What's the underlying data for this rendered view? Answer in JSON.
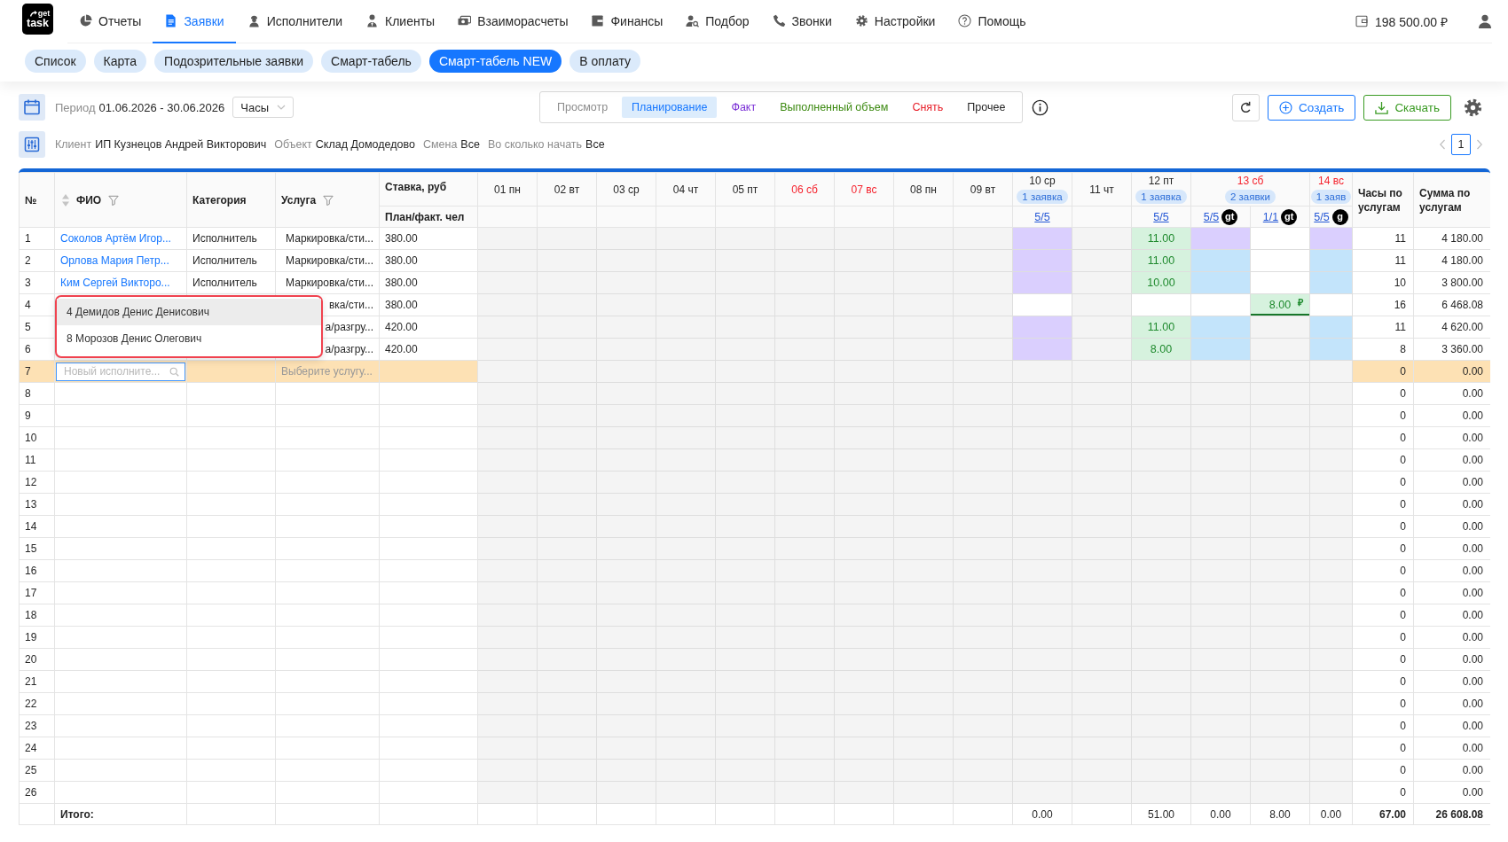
{
  "logo": {
    "lines": [
      "get",
      "task"
    ]
  },
  "nav": {
    "items": [
      {
        "label": "Отчеты",
        "selected": false
      },
      {
        "label": "Заявки",
        "selected": true
      },
      {
        "label": "Исполнители",
        "selected": false
      },
      {
        "label": "Клиенты",
        "selected": false
      },
      {
        "label": "Взаиморасчеты",
        "selected": false
      },
      {
        "label": "Финансы",
        "selected": false
      },
      {
        "label": "Подбор",
        "selected": false
      },
      {
        "label": "Звонки",
        "selected": false
      },
      {
        "label": "Настройки",
        "selected": false
      },
      {
        "label": "Помощь",
        "selected": false
      }
    ],
    "balance": "198 500.00 ₽"
  },
  "subnav": {
    "items": [
      {
        "label": "Список",
        "selected": false
      },
      {
        "label": "Карта",
        "selected": false
      },
      {
        "label": "Подозрительные заявки",
        "selected": false
      },
      {
        "label": "Смарт-табель",
        "selected": false
      },
      {
        "label": "Смарт-табель NEW",
        "selected": true
      },
      {
        "label": "В оплату",
        "selected": false
      }
    ]
  },
  "toolbar": {
    "period": {
      "label": "Период",
      "value": "01.06.2026 - 30.06.2026"
    },
    "unit_select": {
      "value": "Часы"
    },
    "modes": [
      {
        "label": "Просмотр",
        "color": "#8c8c8c",
        "selected": false
      },
      {
        "label": "Планирование",
        "color": "#1677ff",
        "selected": true
      },
      {
        "label": "Факт",
        "color": "#7a2fd6",
        "selected": false
      },
      {
        "label": "Выполненный объем",
        "color": "#3d8a12",
        "selected": false
      },
      {
        "label": "Снять",
        "color": "#e8202a",
        "selected": false
      },
      {
        "label": "Прочее",
        "color": "#1f1f1f",
        "selected": false
      }
    ],
    "buttons": [
      {
        "label": "Создать",
        "kind": "create"
      },
      {
        "label": "Скачать",
        "kind": "download"
      }
    ]
  },
  "filters": [
    {
      "label": "Клиент",
      "value": "ИП Кузнецов Андрей Викторович"
    },
    {
      "label": "Объект",
      "value": "Склад Домодедово"
    },
    {
      "label": "Смена",
      "value": "Все"
    },
    {
      "label": "Во сколько начать",
      "value": "Все"
    }
  ],
  "pagination": {
    "pages": [
      {
        "label": "1",
        "selected": true
      }
    ]
  },
  "table": {
    "columns": {
      "number": "№",
      "name": "ФИО",
      "category": "Категория",
      "service": "Услуга",
      "rate": "Ставка, руб",
      "rate_sub": "План/факт. чел",
      "hours": "Часы по услугам",
      "sum": "Сумма по услугам"
    },
    "days": [
      {
        "label": "01 пн",
        "weekend": false
      },
      {
        "label": "02 вт",
        "weekend": false
      },
      {
        "label": "03 ср",
        "weekend": false
      },
      {
        "label": "04 чт",
        "weekend": false
      },
      {
        "label": "05 пт",
        "weekend": false
      },
      {
        "label": "06 сб",
        "weekend": true
      },
      {
        "label": "07 вс",
        "weekend": true
      },
      {
        "label": "08 пн",
        "weekend": false
      },
      {
        "label": "09 вт",
        "weekend": false
      },
      {
        "label": "10 ср",
        "weekend": false,
        "badge": "1 заявка",
        "slots": [
          {
            "ratio": "5/5",
            "total": "0.00"
          }
        ]
      },
      {
        "label": "11 чт",
        "weekend": false
      },
      {
        "label": "12 пт",
        "weekend": false,
        "badge": "1 заявка",
        "slots": [
          {
            "ratio": "5/5",
            "total": "51.00"
          }
        ]
      },
      {
        "label": "13 сб",
        "weekend": true,
        "badge": "2 заявки",
        "slots": [
          {
            "ratio": "5/5",
            "tag": "gt",
            "total": "0.00"
          },
          {
            "ratio": "1/1",
            "tag": "gt",
            "total": "8.00"
          }
        ]
      },
      {
        "label": "14 вс",
        "weekend": true,
        "badge": "1 заяв",
        "slots": [
          {
            "ratio": "5/5",
            "tag": "g",
            "total": "0.00"
          }
        ]
      }
    ],
    "rows": [
      {
        "number": "1",
        "name": "Соколов Артём Игор...",
        "category": "Исполнитель",
        "service": "Маркировка/сти...",
        "rate": "380.00",
        "hours": "11",
        "sum": "4 180.00",
        "selected": false,
        "cells": [
          {
            "kind": "off"
          },
          {
            "kind": "off"
          },
          {
            "kind": "off"
          },
          {
            "kind": "off"
          },
          {
            "kind": "off"
          },
          {
            "kind": "off"
          },
          {
            "kind": "off"
          },
          {
            "kind": "off"
          },
          {
            "kind": "off"
          },
          {
            "kind": "plan"
          },
          {
            "kind": "off"
          },
          {
            "kind": "done",
            "value": "11.00"
          },
          {
            "kind": "plan"
          },
          {
            "kind": "open"
          },
          {
            "kind": "plan"
          }
        ]
      },
      {
        "number": "2",
        "name": "Орлова Мария Петр...",
        "category": "Исполнитель",
        "service": "Маркировка/сти...",
        "rate": "380.00",
        "hours": "11",
        "sum": "4 180.00",
        "selected": false,
        "cells": [
          {
            "kind": "off"
          },
          {
            "kind": "off"
          },
          {
            "kind": "off"
          },
          {
            "kind": "off"
          },
          {
            "kind": "off"
          },
          {
            "kind": "off"
          },
          {
            "kind": "off"
          },
          {
            "kind": "off"
          },
          {
            "kind": "off"
          },
          {
            "kind": "plan"
          },
          {
            "kind": "off"
          },
          {
            "kind": "done",
            "value": "11.00"
          },
          {
            "kind": "booked"
          },
          {
            "kind": "open"
          },
          {
            "kind": "booked"
          }
        ]
      },
      {
        "number": "3",
        "name": "Ким Сергей Викторо...",
        "category": "Исполнитель",
        "service": "Маркировка/сти...",
        "rate": "380.00",
        "hours": "10",
        "sum": "3 800.00",
        "selected": false,
        "cells": [
          {
            "kind": "off"
          },
          {
            "kind": "off"
          },
          {
            "kind": "off"
          },
          {
            "kind": "off"
          },
          {
            "kind": "off"
          },
          {
            "kind": "off"
          },
          {
            "kind": "off"
          },
          {
            "kind": "off"
          },
          {
            "kind": "off"
          },
          {
            "kind": "plan"
          },
          {
            "kind": "off"
          },
          {
            "kind": "done",
            "value": "10.00"
          },
          {
            "kind": "booked"
          },
          {
            "kind": "open"
          },
          {
            "kind": "booked"
          }
        ]
      },
      {
        "number": "4",
        "service": "вка/сти...",
        "rate": "380.00",
        "hours": "16",
        "sum": "6 468.08",
        "selected": false,
        "cells": [
          {
            "kind": "off"
          },
          {
            "kind": "off"
          },
          {
            "kind": "off"
          },
          {
            "kind": "off"
          },
          {
            "kind": "off"
          },
          {
            "kind": "off"
          },
          {
            "kind": "off"
          },
          {
            "kind": "off"
          },
          {
            "kind": "off"
          },
          {
            "kind": "open"
          },
          {
            "kind": "off"
          },
          {
            "kind": "open"
          },
          {
            "kind": "open"
          },
          {
            "kind": "paid",
            "value": "8.00",
            "mark": "₽"
          },
          {
            "kind": "open"
          }
        ]
      },
      {
        "number": "5",
        "service": "а/разгру...",
        "rate": "420.00",
        "hours": "11",
        "sum": "4 620.00",
        "selected": false,
        "cells": [
          {
            "kind": "off"
          },
          {
            "kind": "off"
          },
          {
            "kind": "off"
          },
          {
            "kind": "off"
          },
          {
            "kind": "off"
          },
          {
            "kind": "off"
          },
          {
            "kind": "off"
          },
          {
            "kind": "off"
          },
          {
            "kind": "off"
          },
          {
            "kind": "plan"
          },
          {
            "kind": "off"
          },
          {
            "kind": "done",
            "value": "11.00"
          },
          {
            "kind": "booked"
          },
          {
            "kind": "off"
          },
          {
            "kind": "booked"
          }
        ]
      },
      {
        "number": "6",
        "service": "а/разгру...",
        "rate": "420.00",
        "hours": "8",
        "sum": "3 360.00",
        "selected": false,
        "cells": [
          {
            "kind": "off"
          },
          {
            "kind": "off"
          },
          {
            "kind": "off"
          },
          {
            "kind": "off"
          },
          {
            "kind": "off"
          },
          {
            "kind": "off"
          },
          {
            "kind": "off"
          },
          {
            "kind": "off"
          },
          {
            "kind": "off"
          },
          {
            "kind": "plan"
          },
          {
            "kind": "off"
          },
          {
            "kind": "done",
            "value": "8.00"
          },
          {
            "kind": "booked"
          },
          {
            "kind": "off"
          },
          {
            "kind": "booked"
          }
        ]
      },
      {
        "number": "7",
        "selected": true,
        "hours": "0",
        "sum": "0.00",
        "name_field": {
          "placeholder": "Новый исполните...",
          "options": [
            {
              "label": "4 Демидов Денис Денисович",
              "selected": true
            },
            {
              "label": "8 Морозов Денис Олегович",
              "selected": false
            }
          ]
        },
        "service_field": {
          "placeholder": "Выберите услугу..."
        }
      },
      {
        "number": "8",
        "hours": "0",
        "sum": "0.00",
        "selected": false
      },
      {
        "number": "9",
        "hours": "0",
        "sum": "0.00",
        "selected": false
      },
      {
        "number": "10",
        "hours": "0",
        "sum": "0.00",
        "selected": false
      },
      {
        "number": "11",
        "hours": "0",
        "sum": "0.00",
        "selected": false
      },
      {
        "number": "12",
        "hours": "0",
        "sum": "0.00",
        "selected": false
      },
      {
        "number": "13",
        "hours": "0",
        "sum": "0.00",
        "selected": false
      },
      {
        "number": "14",
        "hours": "0",
        "sum": "0.00",
        "selected": false
      },
      {
        "number": "15",
        "hours": "0",
        "sum": "0.00",
        "selected": false
      },
      {
        "number": "16",
        "hours": "0",
        "sum": "0.00",
        "selected": false
      },
      {
        "number": "17",
        "hours": "0",
        "sum": "0.00",
        "selected": false
      },
      {
        "number": "18",
        "hours": "0",
        "sum": "0.00",
        "selected": false
      },
      {
        "number": "19",
        "hours": "0",
        "sum": "0.00",
        "selected": false
      },
      {
        "number": "20",
        "hours": "0",
        "sum": "0.00",
        "selected": false
      },
      {
        "number": "21",
        "hours": "0",
        "sum": "0.00",
        "selected": false
      },
      {
        "number": "22",
        "hours": "0",
        "sum": "0.00",
        "selected": false
      },
      {
        "number": "23",
        "hours": "0",
        "sum": "0.00",
        "selected": false
      },
      {
        "number": "24",
        "hours": "0",
        "sum": "0.00",
        "selected": false
      },
      {
        "number": "25",
        "hours": "0",
        "sum": "0.00",
        "selected": false
      },
      {
        "number": "26",
        "hours": "0",
        "sum": "0.00",
        "selected": false
      }
    ],
    "footer": {
      "label": "Итого:",
      "hours": "67.00",
      "sum": "26 608.08"
    }
  }
}
